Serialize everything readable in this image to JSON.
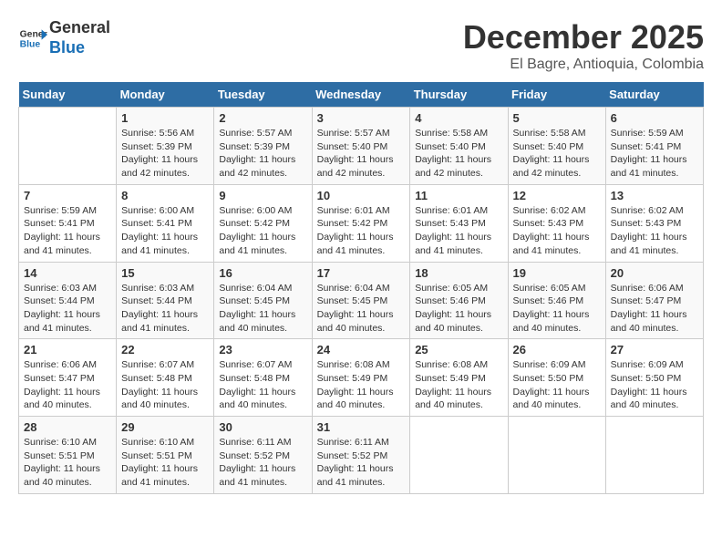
{
  "header": {
    "logo_line1": "General",
    "logo_line2": "Blue",
    "main_title": "December 2025",
    "sub_title": "El Bagre, Antioquia, Colombia"
  },
  "days_of_week": [
    "Sunday",
    "Monday",
    "Tuesday",
    "Wednesday",
    "Thursday",
    "Friday",
    "Saturday"
  ],
  "weeks": [
    [
      {
        "day": "",
        "info": ""
      },
      {
        "day": "1",
        "info": "Sunrise: 5:56 AM\nSunset: 5:39 PM\nDaylight: 11 hours\nand 42 minutes."
      },
      {
        "day": "2",
        "info": "Sunrise: 5:57 AM\nSunset: 5:39 PM\nDaylight: 11 hours\nand 42 minutes."
      },
      {
        "day": "3",
        "info": "Sunrise: 5:57 AM\nSunset: 5:40 PM\nDaylight: 11 hours\nand 42 minutes."
      },
      {
        "day": "4",
        "info": "Sunrise: 5:58 AM\nSunset: 5:40 PM\nDaylight: 11 hours\nand 42 minutes."
      },
      {
        "day": "5",
        "info": "Sunrise: 5:58 AM\nSunset: 5:40 PM\nDaylight: 11 hours\nand 42 minutes."
      },
      {
        "day": "6",
        "info": "Sunrise: 5:59 AM\nSunset: 5:41 PM\nDaylight: 11 hours\nand 41 minutes."
      }
    ],
    [
      {
        "day": "7",
        "info": "Sunrise: 5:59 AM\nSunset: 5:41 PM\nDaylight: 11 hours\nand 41 minutes."
      },
      {
        "day": "8",
        "info": "Sunrise: 6:00 AM\nSunset: 5:41 PM\nDaylight: 11 hours\nand 41 minutes."
      },
      {
        "day": "9",
        "info": "Sunrise: 6:00 AM\nSunset: 5:42 PM\nDaylight: 11 hours\nand 41 minutes."
      },
      {
        "day": "10",
        "info": "Sunrise: 6:01 AM\nSunset: 5:42 PM\nDaylight: 11 hours\nand 41 minutes."
      },
      {
        "day": "11",
        "info": "Sunrise: 6:01 AM\nSunset: 5:43 PM\nDaylight: 11 hours\nand 41 minutes."
      },
      {
        "day": "12",
        "info": "Sunrise: 6:02 AM\nSunset: 5:43 PM\nDaylight: 11 hours\nand 41 minutes."
      },
      {
        "day": "13",
        "info": "Sunrise: 6:02 AM\nSunset: 5:43 PM\nDaylight: 11 hours\nand 41 minutes."
      }
    ],
    [
      {
        "day": "14",
        "info": "Sunrise: 6:03 AM\nSunset: 5:44 PM\nDaylight: 11 hours\nand 41 minutes."
      },
      {
        "day": "15",
        "info": "Sunrise: 6:03 AM\nSunset: 5:44 PM\nDaylight: 11 hours\nand 41 minutes."
      },
      {
        "day": "16",
        "info": "Sunrise: 6:04 AM\nSunset: 5:45 PM\nDaylight: 11 hours\nand 40 minutes."
      },
      {
        "day": "17",
        "info": "Sunrise: 6:04 AM\nSunset: 5:45 PM\nDaylight: 11 hours\nand 40 minutes."
      },
      {
        "day": "18",
        "info": "Sunrise: 6:05 AM\nSunset: 5:46 PM\nDaylight: 11 hours\nand 40 minutes."
      },
      {
        "day": "19",
        "info": "Sunrise: 6:05 AM\nSunset: 5:46 PM\nDaylight: 11 hours\nand 40 minutes."
      },
      {
        "day": "20",
        "info": "Sunrise: 6:06 AM\nSunset: 5:47 PM\nDaylight: 11 hours\nand 40 minutes."
      }
    ],
    [
      {
        "day": "21",
        "info": "Sunrise: 6:06 AM\nSunset: 5:47 PM\nDaylight: 11 hours\nand 40 minutes."
      },
      {
        "day": "22",
        "info": "Sunrise: 6:07 AM\nSunset: 5:48 PM\nDaylight: 11 hours\nand 40 minutes."
      },
      {
        "day": "23",
        "info": "Sunrise: 6:07 AM\nSunset: 5:48 PM\nDaylight: 11 hours\nand 40 minutes."
      },
      {
        "day": "24",
        "info": "Sunrise: 6:08 AM\nSunset: 5:49 PM\nDaylight: 11 hours\nand 40 minutes."
      },
      {
        "day": "25",
        "info": "Sunrise: 6:08 AM\nSunset: 5:49 PM\nDaylight: 11 hours\nand 40 minutes."
      },
      {
        "day": "26",
        "info": "Sunrise: 6:09 AM\nSunset: 5:50 PM\nDaylight: 11 hours\nand 40 minutes."
      },
      {
        "day": "27",
        "info": "Sunrise: 6:09 AM\nSunset: 5:50 PM\nDaylight: 11 hours\nand 40 minutes."
      }
    ],
    [
      {
        "day": "28",
        "info": "Sunrise: 6:10 AM\nSunset: 5:51 PM\nDaylight: 11 hours\nand 40 minutes."
      },
      {
        "day": "29",
        "info": "Sunrise: 6:10 AM\nSunset: 5:51 PM\nDaylight: 11 hours\nand 41 minutes."
      },
      {
        "day": "30",
        "info": "Sunrise: 6:11 AM\nSunset: 5:52 PM\nDaylight: 11 hours\nand 41 minutes."
      },
      {
        "day": "31",
        "info": "Sunrise: 6:11 AM\nSunset: 5:52 PM\nDaylight: 11 hours\nand 41 minutes."
      },
      {
        "day": "",
        "info": ""
      },
      {
        "day": "",
        "info": ""
      },
      {
        "day": "",
        "info": ""
      }
    ]
  ]
}
